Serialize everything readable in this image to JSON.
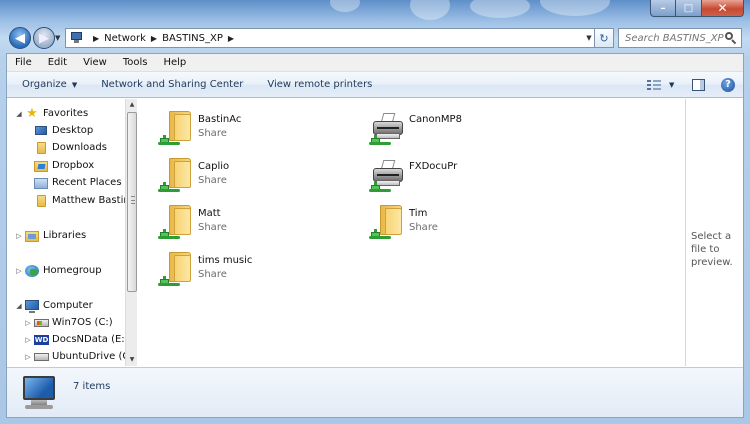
{
  "window": {
    "caption_buttons": {
      "minimize": "–",
      "maximize": "□",
      "close": "✕"
    }
  },
  "nav": {
    "back_glyph": "◀",
    "forward_glyph": "▶",
    "dropdown_glyph": "▼",
    "breadcrumb": [
      "Network",
      "BASTINS_XP"
    ],
    "breadcrumb_separator": "▶",
    "refresh_glyph": "↻",
    "search_placeholder": "Search BASTINS_XP"
  },
  "menubar": [
    "File",
    "Edit",
    "View",
    "Tools",
    "Help"
  ],
  "toolbar": {
    "organize_label": "Organize",
    "network_center_label": "Network and Sharing Center",
    "remote_printers_label": "View remote printers",
    "dropdown_glyph": "▼",
    "help_glyph": "?"
  },
  "navpane": {
    "favorites_label": "Favorites",
    "favorites": [
      "Desktop",
      "Downloads",
      "Dropbox",
      "Recent Places",
      "Matthew Bastin"
    ],
    "libraries_label": "Libraries",
    "homegroup_label": "Homegroup",
    "computer_label": "Computer",
    "drives": [
      "Win7OS (C:)",
      "DocsNData (E:)",
      "UbuntuDrive (G:)"
    ],
    "expanded_glyph": "◢",
    "collapsed_glyph": "▷",
    "wd_badge": "WD"
  },
  "scrollbar": {
    "up_glyph": "▲",
    "down_glyph": "▼"
  },
  "shares": [
    {
      "name": "BastinAc",
      "type": "Share",
      "kind": "folder"
    },
    {
      "name": "CanonMP8",
      "type": "",
      "kind": "printer"
    },
    {
      "name": "Caplio",
      "type": "Share",
      "kind": "folder"
    },
    {
      "name": "FXDocuPr",
      "type": "",
      "kind": "printer"
    },
    {
      "name": "Matt",
      "type": "Share",
      "kind": "folder"
    },
    {
      "name": "Tim",
      "type": "Share",
      "kind": "folder"
    },
    {
      "name": "tims music",
      "type": "Share",
      "kind": "folder"
    }
  ],
  "preview": {
    "text": "Select a file to preview."
  },
  "details": {
    "count_text": "7 items"
  },
  "colors": {
    "accent": "#1e395b",
    "share_pipe": "#2e9e34",
    "folder": "#f8d473"
  }
}
